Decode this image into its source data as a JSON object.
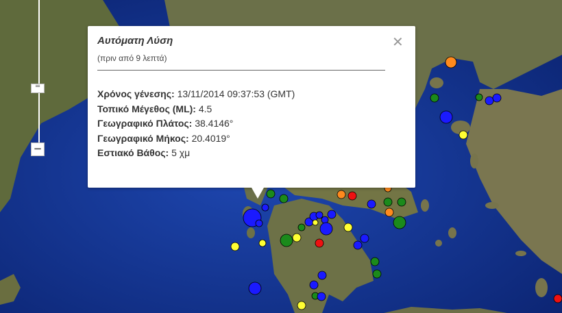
{
  "popup": {
    "title": "Αυτόματη Λύση",
    "subtitle": "(πριν από 9 λεπτά)",
    "rows": [
      {
        "label": "Χρόνος γένεσης:",
        "value": "13/11/2014  09:37:53 (GMT)"
      },
      {
        "label": "Τοπικό Μέγεθος (ML):",
        "value": "4.5"
      },
      {
        "label": "Γεωγραφικό Πλάτος:",
        "value": "38.4146°"
      },
      {
        "label": "Γεωγραφικό Μήκος:",
        "value": "20.4019°"
      },
      {
        "label": "Εστιακό Βάθος:",
        "value": "5 χμ"
      }
    ]
  },
  "icons": {
    "close": "close-icon",
    "zoom_handle": "zoom-slider-handle-icon",
    "zoom_out": "minus-icon"
  },
  "colors": {
    "sea": "#1b3d9e",
    "land": "#6f7a4e",
    "marker_blue": "#1a1aff",
    "marker_green": "#1b8a1b",
    "marker_orange": "#ff8a1e",
    "marker_yellow": "#ffff33",
    "marker_red": "#ee1111"
  },
  "markers": [
    {
      "color": "blue",
      "lat": 38.41,
      "lon": 20.4,
      "mag": 4.5
    }
  ]
}
